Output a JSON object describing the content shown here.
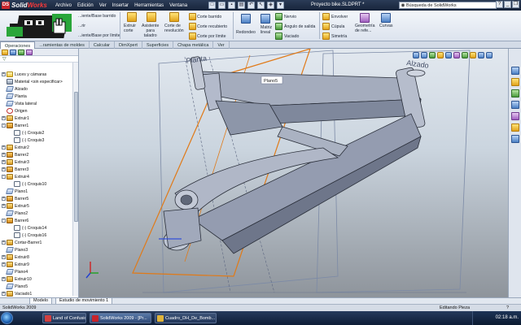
{
  "app": {
    "brand_ds": "DS",
    "brand_name_a": "Solid",
    "brand_name_b": "Works",
    "doc_title": "Proyecto bike.SLDPRT *",
    "search_placeholder": "Búsqueda de SolidWorks"
  },
  "menu": [
    "Archivo",
    "Edición",
    "Ver",
    "Insertar",
    "Herramientas",
    "Ventana"
  ],
  "command_manager": {
    "extrude_boss": "Extruir\nsaliente/Base",
    "sweep_boss": "...iente/Base barrido",
    "loft_boss": "...rir",
    "boundary_boss": "...iente/Base por límite",
    "extrude_cut": "Extruir\ncorte",
    "hole_wizard": "Asistente\npara\ntaladro",
    "revolve_cut": "Corte de\nrevolución",
    "sweep_cut": "Corte barrido",
    "loft_cut": "Corte recubierto",
    "boundary_cut": "Corte por límite",
    "fillet": "Redondeo",
    "linear_pattern": "Matriz\nlineal",
    "rib": "Nervio",
    "draft": "Ángulo de salida",
    "shell": "Vaciado",
    "wrap": "Envolver",
    "dome": "Cúpula",
    "mirror": "Simetría",
    "ref_geometry": "Geometría\nde refe...",
    "curves": "Curvas"
  },
  "tabs": [
    "Operaciones",
    "...ramientas de moldes",
    "Calcular",
    "DimXpert",
    "Superficies",
    "Chapa metálica",
    "Ver"
  ],
  "feature_tree": [
    {
      "label": "Luces y cámaras",
      "icon": "light-icon",
      "indent": 0,
      "twist": "+"
    },
    {
      "label": "Material <sin especificar>",
      "icon": "material-icon",
      "indent": 0,
      "twist": ""
    },
    {
      "label": "Alzado",
      "icon": "plane-icon",
      "indent": 0,
      "twist": ""
    },
    {
      "label": "Planta",
      "icon": "plane-icon",
      "indent": 0,
      "twist": ""
    },
    {
      "label": "Vista lateral",
      "icon": "plane-icon",
      "indent": 0,
      "twist": ""
    },
    {
      "label": "Origen",
      "icon": "origin-icon",
      "indent": 0,
      "twist": ""
    },
    {
      "label": "Extruir1",
      "icon": "extrude-icon",
      "indent": 0,
      "twist": "+"
    },
    {
      "label": "Barrer1",
      "icon": "sweep-icon",
      "indent": 0,
      "twist": "-"
    },
    {
      "label": "(-) Croquis2",
      "icon": "sketch-icon",
      "indent": 1,
      "twist": ""
    },
    {
      "label": "(-) Croquis3",
      "icon": "sketch-icon",
      "indent": 1,
      "twist": ""
    },
    {
      "label": "Extruir2",
      "icon": "extrude-icon",
      "indent": 0,
      "twist": "+"
    },
    {
      "label": "Barrer2",
      "icon": "sweep-icon",
      "indent": 0,
      "twist": "+"
    },
    {
      "label": "Extruir3",
      "icon": "extrude-icon",
      "indent": 0,
      "twist": "+"
    },
    {
      "label": "Barrer3",
      "icon": "sweep-icon",
      "indent": 0,
      "twist": "+"
    },
    {
      "label": "Extruir4",
      "icon": "extrude-icon",
      "indent": 0,
      "twist": "-"
    },
    {
      "label": "(-) Croquis10",
      "icon": "sketch-icon",
      "indent": 1,
      "twist": ""
    },
    {
      "label": "Plano1",
      "icon": "plane-icon",
      "indent": 0,
      "twist": ""
    },
    {
      "label": "Barrer5",
      "icon": "sweep-icon",
      "indent": 0,
      "twist": "+"
    },
    {
      "label": "Extruir5",
      "icon": "extrude-icon",
      "indent": 0,
      "twist": "+"
    },
    {
      "label": "Plano2",
      "icon": "plane-icon",
      "indent": 0,
      "twist": ""
    },
    {
      "label": "Barrer6",
      "icon": "sweep-icon",
      "indent": 0,
      "twist": "-"
    },
    {
      "label": "(-) Croquis14",
      "icon": "sketch-icon",
      "indent": 1,
      "twist": ""
    },
    {
      "label": "(-) Croquis16",
      "icon": "sketch-icon",
      "indent": 1,
      "twist": ""
    },
    {
      "label": "Cortar-Barrer1",
      "icon": "cut-icon",
      "indent": 0,
      "twist": "+"
    },
    {
      "label": "Plano3",
      "icon": "plane-icon",
      "indent": 0,
      "twist": ""
    },
    {
      "label": "Extruir8",
      "icon": "extrude-icon",
      "indent": 0,
      "twist": "+"
    },
    {
      "label": "Extruir9",
      "icon": "extrude-icon",
      "indent": 0,
      "twist": "+"
    },
    {
      "label": "Plano4",
      "icon": "plane-icon",
      "indent": 0,
      "twist": ""
    },
    {
      "label": "Extruir10",
      "icon": "extrude-icon",
      "indent": 0,
      "twist": "+"
    },
    {
      "label": "Plano5",
      "icon": "plane-icon",
      "indent": 0,
      "twist": ""
    },
    {
      "label": "Vaciado1",
      "icon": "shell-icon",
      "indent": 0,
      "twist": "+"
    }
  ],
  "viewport": {
    "plane_label_left": "Planta",
    "plane_label_right": "Alzado",
    "plane_callout": "Plano5"
  },
  "model_tabs": [
    "Modelo",
    "Estudio de movimiento 1"
  ],
  "status": {
    "left": "SolidWorks 2009",
    "editing": "Editando Pieza",
    "help": "?"
  },
  "taskbar": [
    {
      "label": "Land of Confusion ...",
      "icon": "music-icon"
    },
    {
      "label": "SolidWorks 2009 - [Pr...",
      "icon": "solidworks-icon"
    },
    {
      "label": "Cuadro_DH_De_Bomb...",
      "icon": "image-icon"
    }
  ],
  "clock": "02:18 a.m.",
  "colors": {
    "title_bg": "#17233a",
    "accent_orange": "#e07a18",
    "model_fill": "#9aa3b6"
  }
}
